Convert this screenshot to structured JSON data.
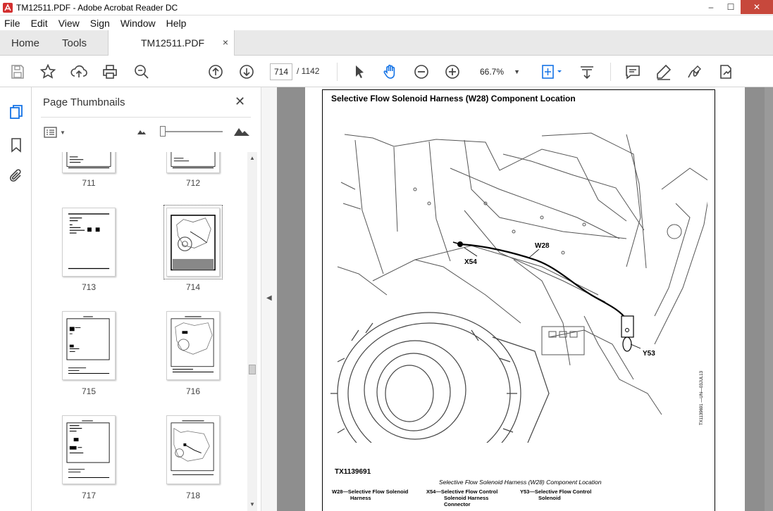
{
  "window": {
    "title": "TM12511.PDF - Adobe Acrobat Reader DC",
    "buttons": {
      "minimize": "–",
      "maximize": "☐",
      "close": "✕"
    }
  },
  "menu": [
    "File",
    "Edit",
    "View",
    "Sign",
    "Window",
    "Help"
  ],
  "tabs": {
    "home": "Home",
    "tools": "Tools",
    "document": "TM12511.PDF",
    "close": "×"
  },
  "toolbar": {
    "current_page": "714",
    "total_pages": "/ 1142",
    "zoom": "66.7%",
    "icons": [
      "save-icon",
      "bookmark-star-icon",
      "upload-icon",
      "print-icon",
      "zoom-search-icon",
      "page-up-icon",
      "page-down-icon",
      "select-arrow-icon",
      "hand-icon",
      "zoom-out-icon",
      "zoom-in-icon",
      "fit-page-icon",
      "scroll-mode-icon",
      "comment-icon",
      "highlight-icon",
      "sign-icon",
      "more-tools-icon"
    ]
  },
  "sidebar": {
    "title": "Page Thumbnails",
    "close": "✕",
    "thumbnails": [
      {
        "label": "711"
      },
      {
        "label": "712"
      },
      {
        "label": "713"
      },
      {
        "label": "714"
      },
      {
        "label": "715"
      },
      {
        "label": "716"
      },
      {
        "label": "717"
      },
      {
        "label": "718"
      }
    ],
    "selected": "714"
  },
  "document": {
    "title": "Selective Flow Solenoid Harness (W28) Component Location",
    "callouts": {
      "w28": "W28",
      "x54": "X54",
      "y53": "Y53"
    },
    "figure_id": "TX1139691",
    "side_id": "TX1139691 —UN—03JUL13",
    "caption": "Selective Flow Solenoid Harness (W28) Component Location",
    "legend": [
      {
        "key": "W28—",
        "text1": "Selective Flow Solenoid",
        "text2": "Harness",
        "text3": ""
      },
      {
        "key": "X54—",
        "text1": "Selective Flow Control",
        "text2": "Solenoid Harness",
        "text3": "Connector"
      },
      {
        "key": "Y53—",
        "text1": "Selective Flow Control",
        "text2": "Solenoid",
        "text3": ""
      }
    ]
  }
}
